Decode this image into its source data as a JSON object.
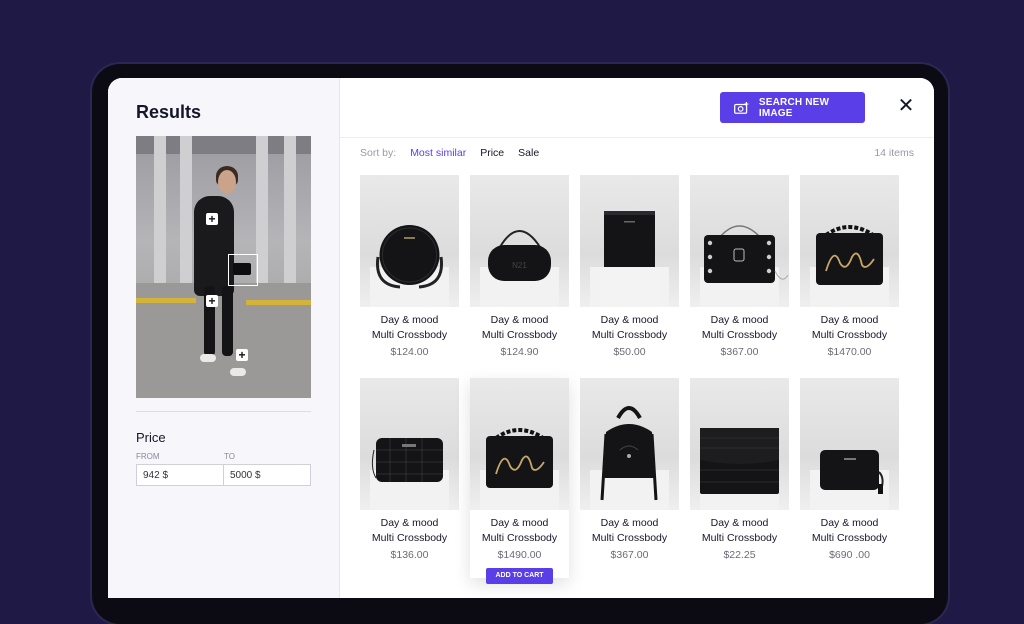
{
  "colors": {
    "accent": "#5a3ee8",
    "background": "#1e1a45"
  },
  "sidebar": {
    "title": "Results",
    "price": {
      "label": "Price",
      "from_label": "FROM",
      "to_label": "TO",
      "from_value": "942 $",
      "to_value": "5000 $"
    }
  },
  "header": {
    "search_button": "SEARCH NEW IMAGE",
    "search_icon": "camera-plus-icon",
    "close_icon": "close-icon"
  },
  "sort": {
    "label": "Sort by:",
    "options": [
      "Most similar",
      "Price",
      "Sale"
    ],
    "active": "Most similar",
    "items_count": "14 items"
  },
  "products": [
    {
      "brand": "Day & mood",
      "name": "Multi Crossbody",
      "price": "$124.00",
      "shape": "round"
    },
    {
      "brand": "Day & mood",
      "name": "Multi Crossbody",
      "price": "$124.90",
      "shape": "barrel"
    },
    {
      "brand": "Day & mood",
      "name": "Multi Crossbody",
      "price": "$50.00",
      "shape": "rect"
    },
    {
      "brand": "Day & mood",
      "name": "Multi Crossbody",
      "price": "$367.00",
      "shape": "studded"
    },
    {
      "brand": "Day & mood",
      "name": "Multi Crossbody",
      "price": "$1470.00",
      "shape": "karl"
    },
    {
      "brand": "Day & mood",
      "name": "Multi Crossbody",
      "price": "$136.00",
      "shape": "croc"
    },
    {
      "brand": "Day & mood",
      "name": "Multi Crossbody",
      "price": "$1490.00",
      "shape": "karl",
      "cta": "ADD TO CART"
    },
    {
      "brand": "Day & mood",
      "name": "Multi Crossbody",
      "price": "$367.00",
      "shape": "backpack"
    },
    {
      "brand": "Day & mood",
      "name": "Multi Crossbody",
      "price": "$22.25",
      "shape": "flap"
    },
    {
      "brand": "Day & mood",
      "name": "Multi Crossbody",
      "price": "$690 .00",
      "shape": "small"
    }
  ]
}
